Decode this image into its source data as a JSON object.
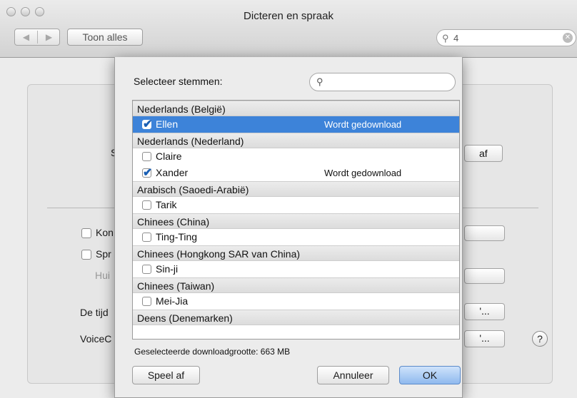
{
  "window": {
    "title": "Dicteren en spraak"
  },
  "toolbar": {
    "back": "◀",
    "forward": "▶",
    "show_all": "Toon alles",
    "search_value": "4",
    "search_icon": "search-icon",
    "clear_icon": "clear-icon"
  },
  "background": {
    "fragments": {
      "sp": "Sp",
      "af": "af",
      "kon": "Kon",
      "spr": "Spr",
      "hui": "Hui",
      "tijd": "De tijd",
      "voice": "VoiceC",
      "ellipsis": "'..."
    },
    "help": "?"
  },
  "sheet": {
    "title": "Selecteer stemmen:",
    "search_placeholder": "",
    "groups": [
      {
        "name": "Nederlands (België)",
        "voices": [
          {
            "name": "Ellen",
            "checked": true,
            "selected": true,
            "status": "Wordt gedownload"
          }
        ]
      },
      {
        "name": "Nederlands (Nederland)",
        "voices": [
          {
            "name": "Claire",
            "checked": false,
            "selected": false,
            "status": ""
          },
          {
            "name": "Xander",
            "checked": true,
            "selected": false,
            "status": "Wordt gedownload"
          }
        ]
      },
      {
        "name": "Arabisch (Saoedi-Arabië)",
        "voices": [
          {
            "name": "Tarik",
            "checked": false,
            "selected": false,
            "status": ""
          }
        ]
      },
      {
        "name": "Chinees (China)",
        "voices": [
          {
            "name": "Ting-Ting",
            "checked": false,
            "selected": false,
            "status": ""
          }
        ]
      },
      {
        "name": "Chinees (Hongkong SAR van China)",
        "voices": [
          {
            "name": "Sin-ji",
            "checked": false,
            "selected": false,
            "status": ""
          }
        ]
      },
      {
        "name": "Chinees (Taiwan)",
        "voices": [
          {
            "name": "Mei-Jia",
            "checked": false,
            "selected": false,
            "status": ""
          }
        ]
      },
      {
        "name": "Deens (Denemarken)",
        "voices": []
      }
    ],
    "download_size": "Geselecteerde downloadgrootte: 663 MB",
    "play_label": "Speel af",
    "cancel_label": "Annuleer",
    "ok_label": "OK"
  }
}
